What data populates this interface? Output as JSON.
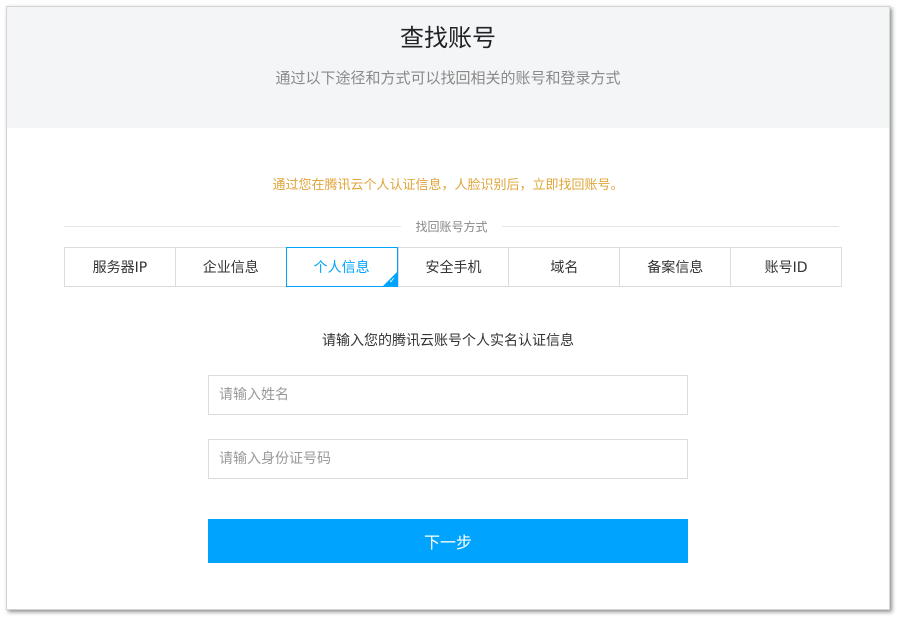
{
  "header": {
    "title": "查找账号",
    "subtitle": "通过以下途径和方式可以找回相关的账号和登录方式"
  },
  "notice": "通过您在腾讯云个人认证信息，人脸识别后，立即找回账号。",
  "divider_label": "找回账号方式",
  "tabs": [
    {
      "label": "服务器IP",
      "active": false
    },
    {
      "label": "企业信息",
      "active": false
    },
    {
      "label": "个人信息",
      "active": true
    },
    {
      "label": "安全手机",
      "active": false
    },
    {
      "label": "域名",
      "active": false
    },
    {
      "label": "备案信息",
      "active": false
    },
    {
      "label": "账号ID",
      "active": false
    }
  ],
  "form": {
    "prompt": "请输入您的腾讯云账号个人实名认证信息",
    "name_placeholder": "请输入姓名",
    "name_value": "",
    "id_placeholder": "请输入身份证号码",
    "id_value": "",
    "next_label": "下一步"
  },
  "colors": {
    "accent": "#00a4ff",
    "notice": "#e0a53a",
    "header_bg": "#f4f5f7"
  },
  "icons": {
    "active_tab_marker": "check-icon"
  }
}
